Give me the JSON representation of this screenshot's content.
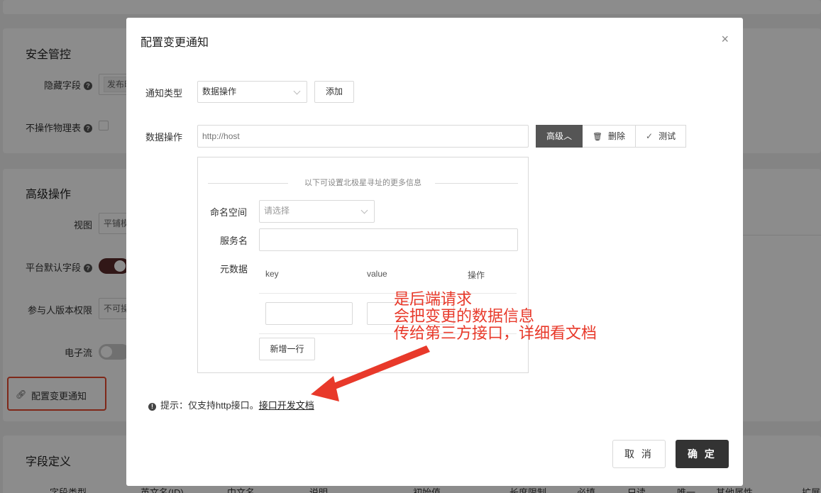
{
  "background": {
    "security_section": {
      "title": "安全管控",
      "hidden_field_label": "隐藏字段",
      "hidden_field_value": "发布时",
      "no_physical_table_label": "不操作物理表"
    },
    "advanced_section": {
      "title": "高级操作",
      "view_label": "视图",
      "view_value": "平铺模",
      "default_field_label": "平台默认字段",
      "participant_perm_label": "参与人版本权限",
      "participant_perm_value": "不可操",
      "eflow_label": "电子流",
      "notify_config_label": "配置变更通知"
    },
    "fields_section": {
      "title": "字段定义",
      "columns": [
        "字段类型",
        "英文名(ID)",
        "中文名",
        "说明",
        "初始值",
        "长度限制",
        "必填",
        "只读",
        "唯一",
        "其他属性",
        "扩展"
      ]
    }
  },
  "modal": {
    "title": "配置变更通知",
    "close_glyph": "×",
    "notify_type_label": "通知类型",
    "notify_type_value": "数据操作",
    "add_button": "添加",
    "data_op_label": "数据操作",
    "url_placeholder": "http://host",
    "advanced_button": "高级",
    "advanced_caret": "︿",
    "delete_button": "删除",
    "test_button": "测试",
    "panel": {
      "divider_text": "以下可设置北极星寻址的更多信息",
      "namespace_label": "命名空间",
      "namespace_placeholder": "请选择",
      "service_label": "服务名",
      "metadata_label": "元数据",
      "col_key": "key",
      "col_value": "value",
      "col_action": "操作",
      "add_row_button": "新增一行"
    },
    "hint_prefix": "提示：仅支持http接口。",
    "hint_link": "接口开发文档",
    "cancel_button": "取 消",
    "ok_button": "确 定"
  },
  "annotation": {
    "lines": [
      "是后端请求",
      "会把变更的数据信息",
      "传给第三方接口，详细看文档"
    ]
  },
  "colors": {
    "accent_dark": "#333333",
    "toggle_on": "#5a2a2a",
    "annotation_red": "#e8392a"
  },
  "icons": {
    "help": "question-circle-icon",
    "link": "link-icon",
    "trash": "trash-icon",
    "check": "check-icon",
    "info": "exclamation-circle-icon"
  }
}
